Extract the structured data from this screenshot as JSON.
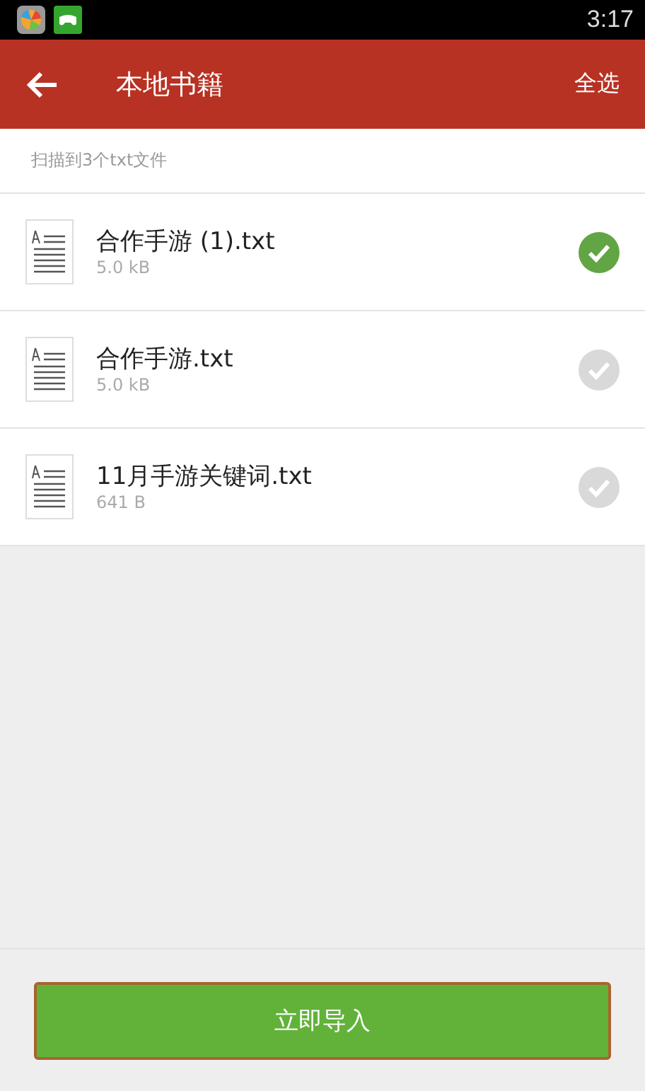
{
  "status_bar": {
    "time": "3:17"
  },
  "header": {
    "title": "本地书籍",
    "action": "全选"
  },
  "scan_summary": "扫描到3个txt文件",
  "files": [
    {
      "name": "合作手游 (1).txt",
      "size": "5.0 kB",
      "checked": true
    },
    {
      "name": "合作手游.txt",
      "size": "5.0 kB",
      "checked": false
    },
    {
      "name": "11月手游关键词.txt",
      "size": "641 B",
      "checked": false
    }
  ],
  "import_button": "立即导入"
}
